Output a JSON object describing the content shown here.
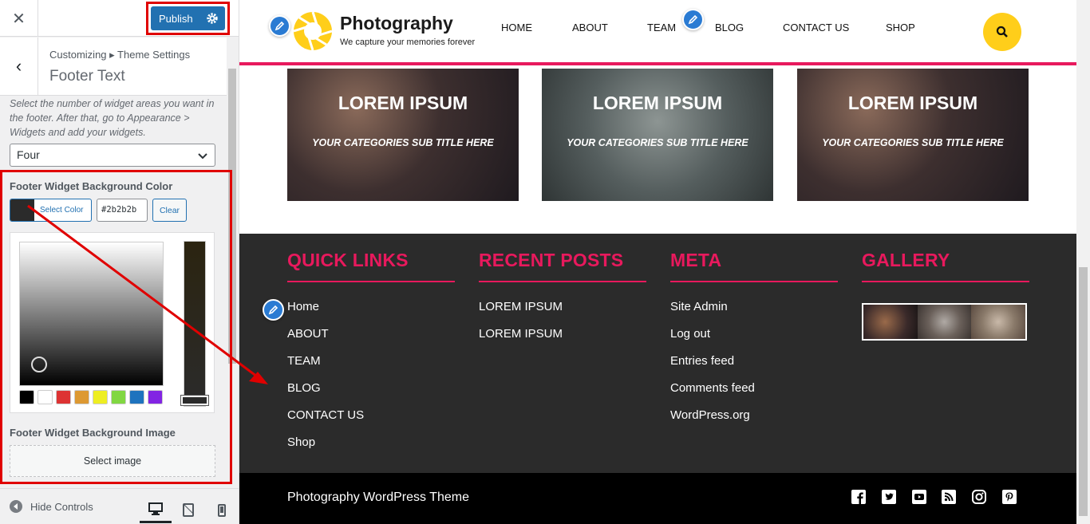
{
  "customizer": {
    "publish_label": "Publish",
    "breadcrumb": "Customizing ▸ Theme Settings",
    "section_title": "Footer Text",
    "description": "Select the number of widget areas you want in the footer. After that, go to Appearance > Widgets and add your widgets.",
    "widget_count_select": "Four",
    "bg_color_label": "Footer Widget Background Color",
    "select_color_label": "Select Color",
    "hex_value": "#2b2b2b",
    "clear_label": "Clear",
    "bg_image_label": "Footer Widget Background Image",
    "select_image_label": "Select image",
    "hide_controls_label": "Hide Controls",
    "palette": [
      "#000000",
      "#ffffff",
      "#dd3333",
      "#dd9933",
      "#eeee22",
      "#81d742",
      "#1e73be",
      "#8224e3"
    ]
  },
  "site": {
    "title": "Photography",
    "tagline": "We capture your memories forever",
    "nav": [
      "HOME",
      "ABOUT",
      "TEAM",
      "BLOG",
      "CONTACT US",
      "SHOP"
    ],
    "accent": "#e8195d",
    "search_color": "#ffce1a"
  },
  "categories": [
    {
      "title": "LOREM IPSUM",
      "subtitle": "YOUR CATEGORIES SUB TITLE HERE"
    },
    {
      "title": "LOREM IPSUM",
      "subtitle": "YOUR CATEGORIES SUB TITLE HERE"
    },
    {
      "title": "LOREM IPSUM",
      "subtitle": "YOUR CATEGORIES SUB TITLE HERE"
    }
  ],
  "footer": {
    "quick_links": {
      "title": "QUICK LINKS",
      "items": [
        "Home",
        "ABOUT",
        "TEAM",
        "BLOG",
        "CONTACT US",
        "Shop"
      ]
    },
    "recent_posts": {
      "title": "RECENT POSTS",
      "items": [
        "LOREM IPSUM",
        "LOREM IPSUM"
      ]
    },
    "meta": {
      "title": "META",
      "items": [
        "Site Admin",
        "Log out",
        "Entries feed",
        "Comments feed",
        "WordPress.org"
      ]
    },
    "gallery": {
      "title": "GALLERY"
    },
    "copyright": "Photography WordPress Theme",
    "social_icons": [
      "facebook-icon",
      "twitter-icon",
      "youtube-icon",
      "rss-icon",
      "instagram-icon",
      "pinterest-icon"
    ]
  }
}
